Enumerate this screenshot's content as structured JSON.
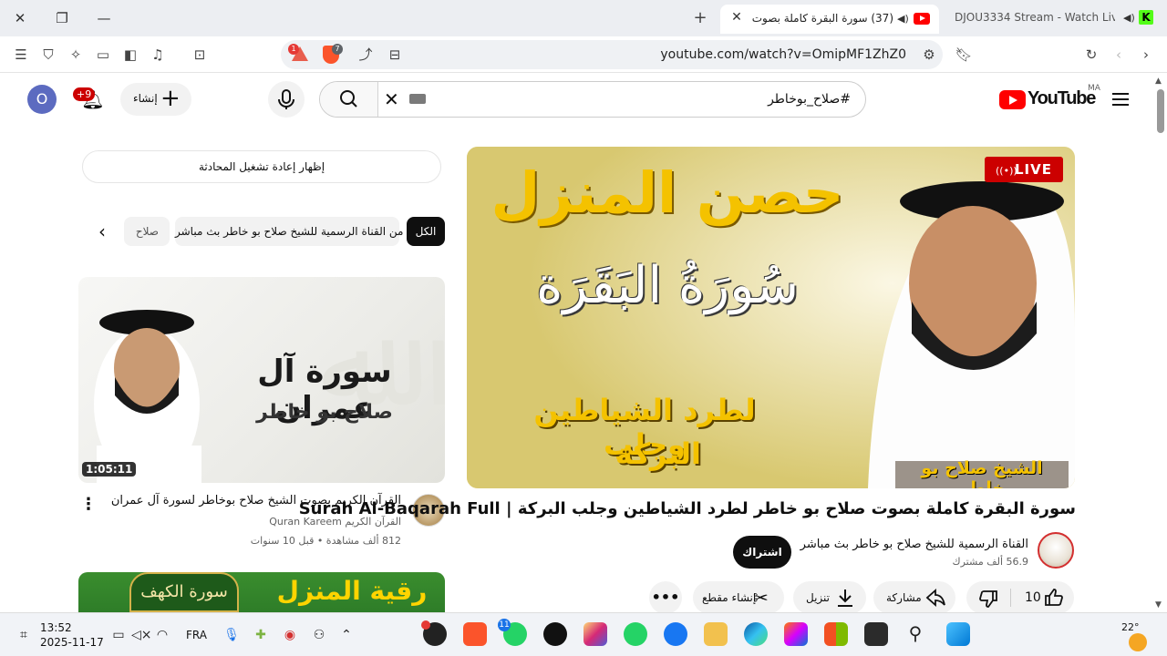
{
  "browser": {
    "active_tab_title": "(37) سورة البقرة كاملة بصوت",
    "second_tab_title": "DJOU3334 Stream - Watch Live o",
    "url": "youtube.com/watch?v=OmipMF1ZhZ0",
    "ext_badge_1": "1",
    "ext_badge_2": "7"
  },
  "youtube": {
    "logo_text": "YouTube",
    "country_code": "MA",
    "search_query": "#صلاح_بوخاطر",
    "create_label": "إنشاء",
    "notifications_badge": "+9",
    "avatar_letter": "O"
  },
  "sidebar": {
    "chat_replay": "إظهار إعادة تشغيل المحادثة",
    "chips": [
      {
        "label": "الكل"
      },
      {
        "label": "من القناة الرسمية للشيخ صلاح بو خاطر بث مباشر"
      },
      {
        "label": "صلاح"
      }
    ],
    "recommendations": [
      {
        "thumb_text_1": "سورة آل عمران",
        "thumb_text_2": "صلاح بو خاطر",
        "duration": "1:05:11",
        "title": "القرآن الكريم بصوت الشيخ صلاح بوخاطر لسورة آل عمران",
        "channel": "Quran Kareem القرآن الكريم",
        "meta": "812 ألف مشاهدة • قبل 10 سنوات"
      },
      {
        "thumb_text_1": "رقية المنزل",
        "thumb_text_2": "سورة الكهف"
      }
    ]
  },
  "video": {
    "live_label": "LIVE",
    "thumb_heading": "حصن المنزل",
    "thumb_surah": "سُورَةُ البَقَرَة",
    "thumb_line_1": "لطرد الشياطين وجلب",
    "thumb_line_2": "البركة",
    "thumb_sheikh": "الشيخ صلاح بو خاطر",
    "title": "سورة البقرة كاملة بصوت صلاح بو خاطر لطرد الشياطين وجلب البركة | Surah Al-Baqarah Full",
    "channel": "القناة الرسمية للشيخ صلاح بو خاطر بث مباشر",
    "subscribers": "56.9 ألف مشترك",
    "subscribe_label": "اشتراك",
    "like_count": "10",
    "share_label": "مشاركة",
    "download_label": "تنزيل",
    "clip_label": "إنشاء مقطع"
  },
  "taskbar": {
    "time": "13:52",
    "date": "2025-11-17",
    "language": "FRA",
    "temperature": "22°",
    "whatsapp_badge": "11"
  }
}
